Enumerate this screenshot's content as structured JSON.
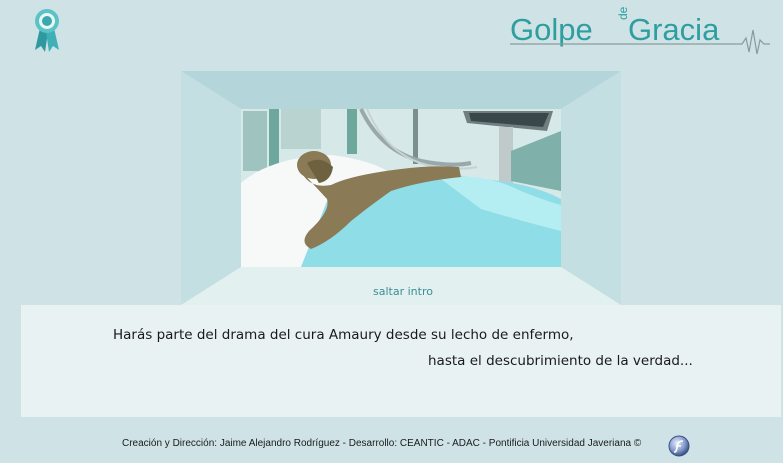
{
  "logo": {
    "word1": "Golpe",
    "de": "de",
    "word2": "Gracia"
  },
  "icons": {
    "award": "award-ribbon-icon",
    "flash": "flash-player-icon"
  },
  "skip_label": "saltar intro",
  "intro": {
    "line1": "Harás parte del drama del cura Amaury desde su lecho de enfermo,",
    "line2": "hasta el descubrimiento de la verdad..."
  },
  "footer": {
    "credits": "Creación y Dirección: Jaime Alejandro Rodríguez - Desarrollo: CEANTIC - ADAC - Pontificia Universidad Javeriana ©"
  },
  "colors": {
    "background": "#cfe3e6",
    "panel": "#e8f2f2",
    "accent": "#2f9ea0",
    "skip_link": "#3a8f95"
  }
}
